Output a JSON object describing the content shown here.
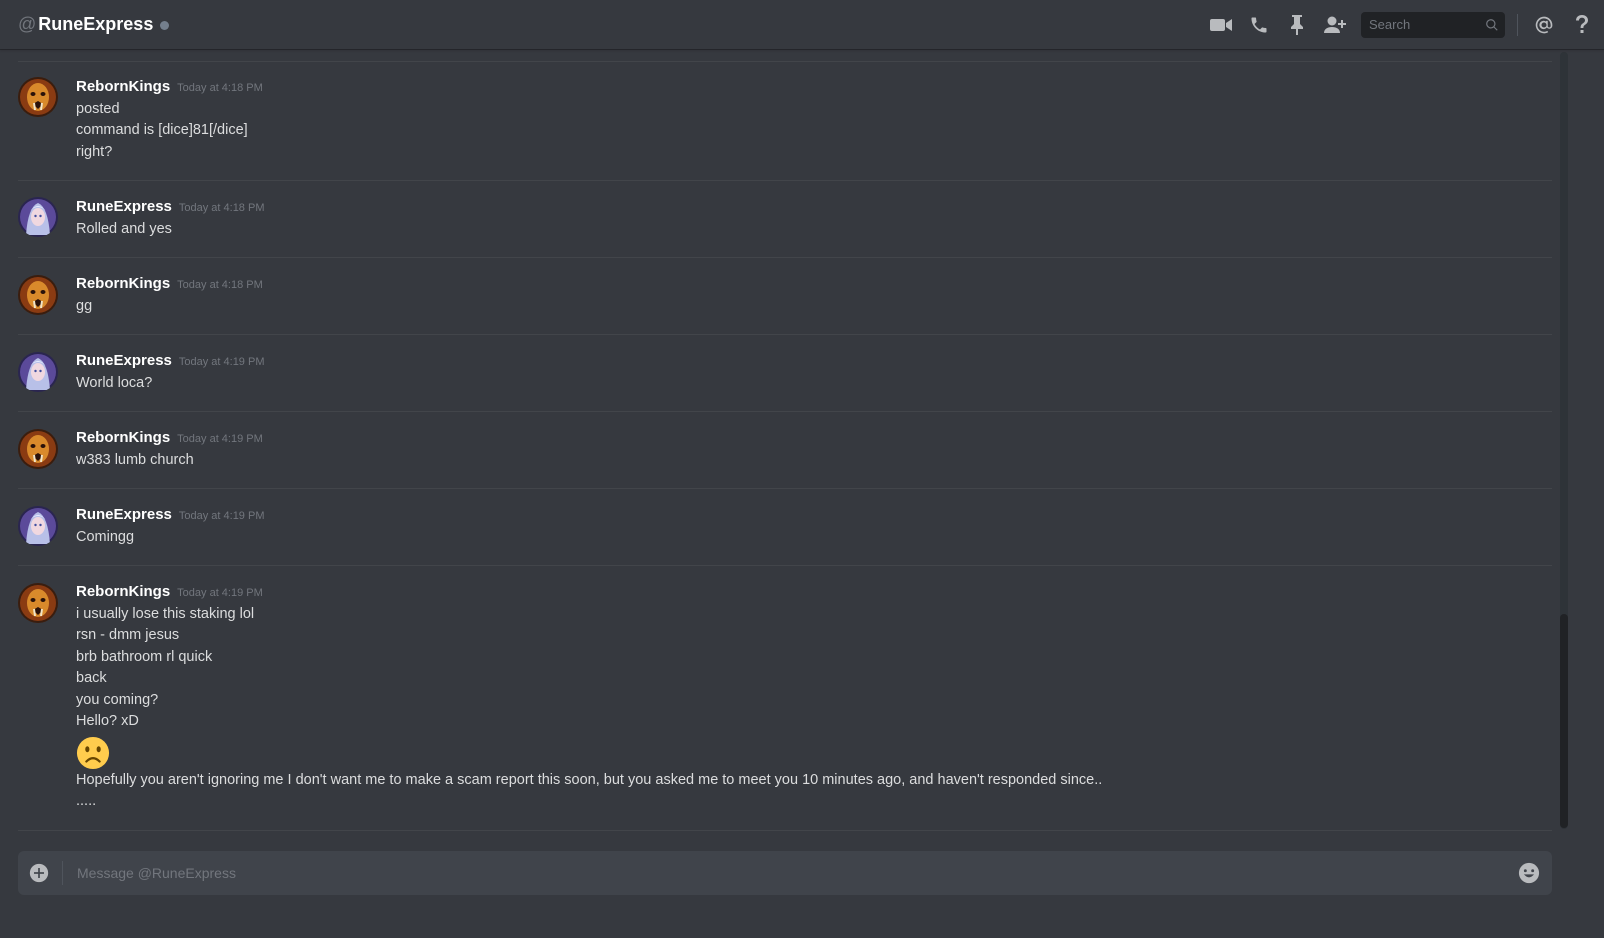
{
  "header": {
    "at_symbol": "@",
    "channel_name": "RuneExpress",
    "status": "offline",
    "search_placeholder": "Search",
    "icons": [
      "video-call-icon",
      "voice-call-icon",
      "pin-icon",
      "add-friend-icon",
      "search-icon",
      "mention-icon",
      "help-icon"
    ]
  },
  "messages": [
    {
      "author": "RebornKings",
      "timestamp": "Today at 4:18 PM",
      "lines": [
        "posted",
        "command is [dice]81[/dice]",
        "right?"
      ]
    },
    {
      "author": "RuneExpress",
      "timestamp": "Today at 4:18 PM",
      "lines": [
        "Rolled and yes"
      ]
    },
    {
      "author": "RebornKings",
      "timestamp": "Today at 4:18 PM",
      "lines": [
        "gg"
      ]
    },
    {
      "author": "RuneExpress",
      "timestamp": "Today at 4:19 PM",
      "lines": [
        "World loca?"
      ]
    },
    {
      "author": "RebornKings",
      "timestamp": "Today at 4:19 PM",
      "lines": [
        "w383 lumb church"
      ]
    },
    {
      "author": "RuneExpress",
      "timestamp": "Today at 4:19 PM",
      "lines": [
        "Comingg"
      ]
    },
    {
      "author": "RebornKings",
      "timestamp": "Today at 4:19 PM",
      "lines": [
        "i usually lose this staking lol",
        "rsn - dmm jesus",
        "brb bathroom rl quick",
        "back",
        "you coming?",
        "Hello? xD"
      ],
      "emoji": "frowning-face-emoji",
      "after_emoji": [
        "Hopefully you aren't ignoring me I don't want me to make a scam report this soon, but you asked me to meet you 10 minutes ago, and haven't responded since..",
        "....."
      ]
    }
  ],
  "composer": {
    "placeholder": "Message @RuneExpress"
  },
  "colors": {
    "background": "#36393f",
    "input_background": "#40444b",
    "search_background": "#202225",
    "username": "#ffffff",
    "timestamp": "#72767d",
    "text": "#dcddde",
    "icon": "#b9bbbe",
    "emoji_yellow": "#ffcc4d"
  }
}
